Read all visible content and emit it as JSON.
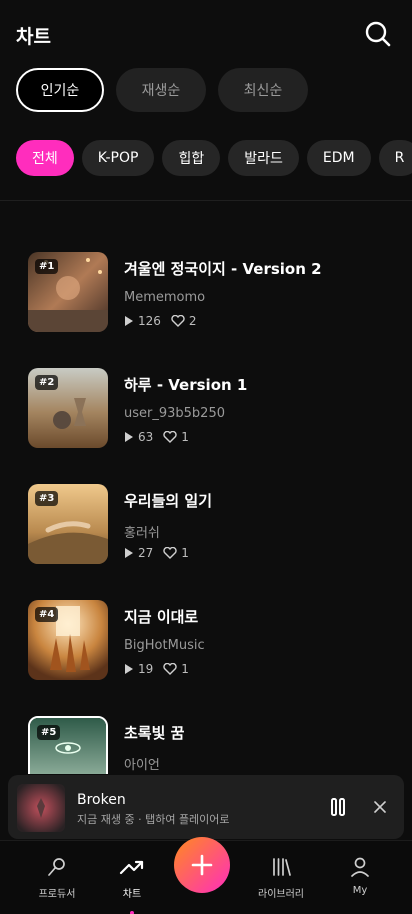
{
  "header": {
    "title": "차트"
  },
  "sort_tabs": [
    "인기순",
    "재생순",
    "최신순"
  ],
  "genres": [
    "전체",
    "K-POP",
    "힙합",
    "발라드",
    "EDM",
    "R"
  ],
  "songs": [
    {
      "rank": "#1",
      "title": "겨울엔 정국이지 - Version 2",
      "artist": "Mememomo",
      "plays": "126",
      "likes": "2"
    },
    {
      "rank": "#2",
      "title": "하루 - Version 1",
      "artist": "user_93b5b250",
      "plays": "63",
      "likes": "1"
    },
    {
      "rank": "#3",
      "title": "우리들의 일기",
      "artist": "홍러쉬",
      "plays": "27",
      "likes": "1"
    },
    {
      "rank": "#4",
      "title": "지금 이대로",
      "artist": "BigHotMusic",
      "plays": "19",
      "likes": "1"
    },
    {
      "rank": "#5",
      "title": "초록빛 꿈",
      "artist": "아이언",
      "plays": "",
      "likes": ""
    }
  ],
  "mini_player": {
    "title": "Broken",
    "subtitle": "지금 재생 중 · 탭하여 플레이어로"
  },
  "nav": {
    "producer": "프로듀서",
    "chart": "차트",
    "library": "라이브러리",
    "my": "My"
  },
  "colors": {
    "accent": "#ff2dbd",
    "background": "#0d0d0d",
    "chip": "#262626"
  },
  "icons": [
    "search-icon",
    "play-icon",
    "heart-icon",
    "pause-icon",
    "close-icon",
    "producer-icon",
    "trending-icon",
    "plus-icon",
    "library-icon",
    "user-icon"
  ]
}
